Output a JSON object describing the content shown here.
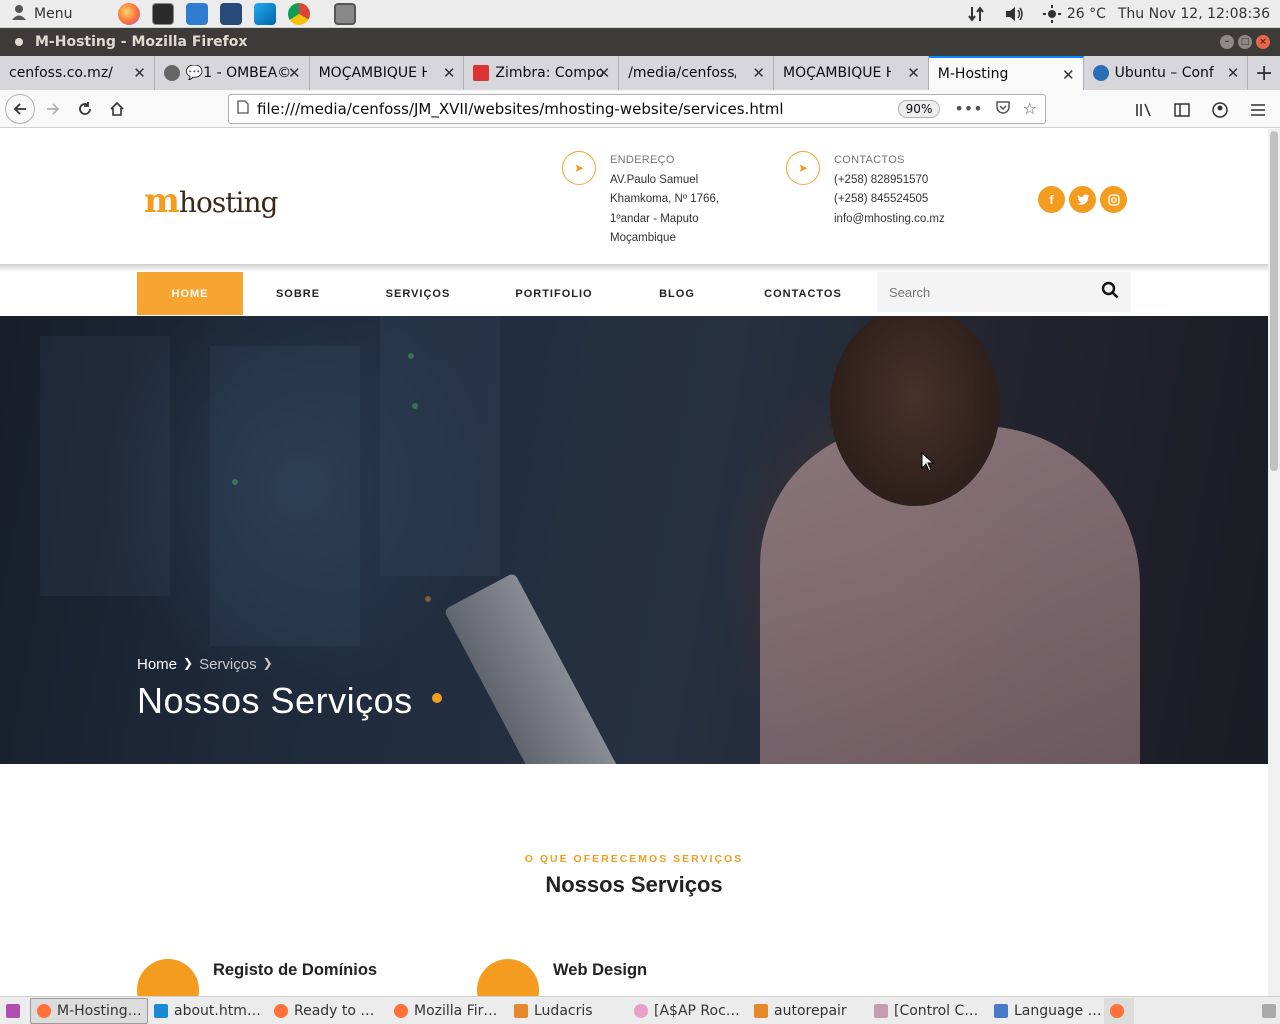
{
  "os_panel": {
    "menu_label": "Menu",
    "launchers": [
      "firefox-icon",
      "terminal-icon",
      "system-monitor-icon",
      "image-editor-icon",
      "vscode-icon",
      "chrome-icon",
      "screenshot-icon"
    ],
    "temperature": "26 °C",
    "clock": "Thu Nov 12, 12:08:36"
  },
  "window": {
    "title": "M-Hosting - Mozilla Firefox"
  },
  "tabs": [
    {
      "label": "cenfoss.co.mz/",
      "color": "#d7d7db"
    },
    {
      "label": "💬1 - OMBEA©",
      "color": "#777777"
    },
    {
      "label": "MOÇAMBIQUE HO",
      "color": "#d7d7db"
    },
    {
      "label": "Zimbra: Compo",
      "color": "#d33"
    },
    {
      "label": "/media/cenfoss/J",
      "color": "#d7d7db"
    },
    {
      "label": "MOÇAMBIQUE HO",
      "color": "#d7d7db"
    },
    {
      "label": "M-Hosting",
      "color": "#f9f9fa",
      "active": true
    },
    {
      "label": "Ubuntu – Conf",
      "color": "#2a6fb5"
    }
  ],
  "navbar": {
    "url": "file:///media/cenfoss/JM_XVII/websites/mhosting-website/services.html",
    "zoom": "90%"
  },
  "site": {
    "logo_m": "m",
    "logo_rest": "hosting",
    "address": {
      "label": "ENDEREÇO",
      "lines": [
        "AV.Paulo Samuel",
        "Khamkoma, Nº 1766,",
        "1ºandar - Maputo",
        "Moçambique"
      ]
    },
    "contacts": {
      "label": "CONTACTOS",
      "lines": [
        "(+258) 828951570",
        "(+258) 845524505",
        "info@mhosting.co.mz"
      ]
    },
    "social": [
      "f",
      "t",
      "ig"
    ],
    "nav": [
      "HOME",
      "SOBRE",
      "SERVIÇOS",
      "PORTIFOLIO",
      "BLOG",
      "CONTACTOS"
    ],
    "search_placeholder": "Search",
    "breadcrumb": {
      "home": "Home",
      "current": "Serviços"
    },
    "hero_title": "Nossos Serviços",
    "eyebrow": "O QUE OFERECEMOS SERVIÇOS",
    "section_title": "Nossos Serviços",
    "services": [
      "Registo de Domínios",
      "Web Design"
    ],
    "accent": "#f39c1f"
  },
  "taskbar": [
    {
      "label": "M-Hosting…",
      "active": true
    },
    {
      "label": "about.htm…"
    },
    {
      "label": "Ready to …"
    },
    {
      "label": "Mozilla Fir…"
    },
    {
      "label": "Ludacris"
    },
    {
      "label": "[A$AP Roc…"
    },
    {
      "label": "autorepair"
    },
    {
      "label": "[Control C…"
    },
    {
      "label": "Language …"
    }
  ]
}
